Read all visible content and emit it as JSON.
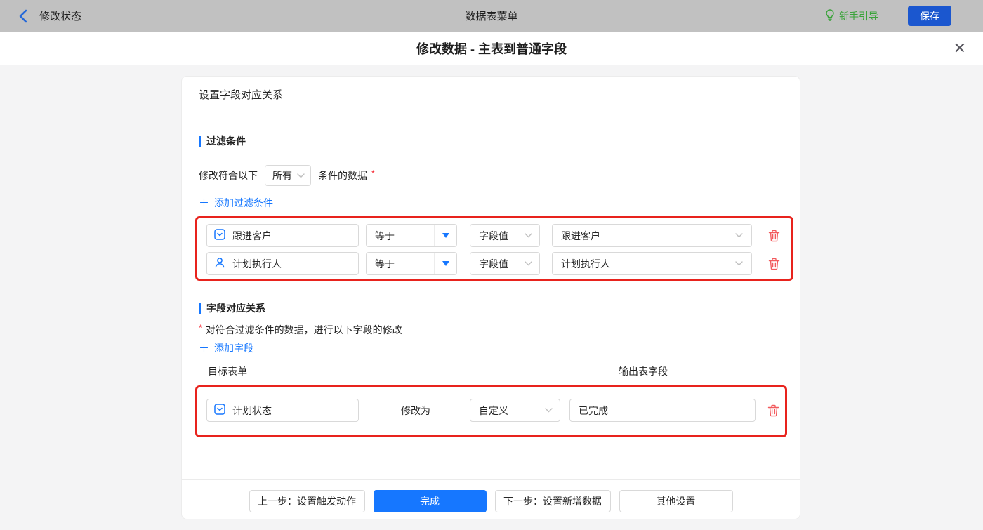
{
  "topbar": {
    "back_label": "修改状态",
    "center_title": "数据表菜单",
    "guide_label": "新手引导",
    "save_label": "保存"
  },
  "modal": {
    "title": "修改数据 - 主表到普通字段"
  },
  "card": {
    "header": "设置字段对应关系",
    "filter_section": {
      "title": "过滤条件",
      "condition_prefix": "修改符合以下",
      "condition_select_value": "所有",
      "condition_suffix": "条件的数据",
      "required_mark": "*",
      "add_label": "添加过滤条件",
      "rows": [
        {
          "field": "跟进客户",
          "field_icon": "select-field-icon",
          "operator": "等于",
          "value_type": "字段值",
          "value": "跟进客户"
        },
        {
          "field": "计划执行人",
          "field_icon": "user-field-icon",
          "operator": "等于",
          "value_type": "字段值",
          "value": "计划执行人"
        }
      ]
    },
    "mapping_section": {
      "title": "字段对应关系",
      "required_mark": "*",
      "description": "对符合过滤条件的数据，进行以下字段的修改",
      "add_label": "添加字段",
      "col_target": "目标表单",
      "col_output": "输出表字段",
      "rows": [
        {
          "field": "计划状态",
          "field_icon": "select-field-icon",
          "action_label": "修改为",
          "mode": "自定义",
          "value": "已完成"
        }
      ]
    },
    "footer": {
      "prev_label": "上一步：设置触发动作",
      "done_label": "完成",
      "next_label": "下一步：设置新增数据",
      "other_label": "其他设置"
    }
  },
  "icons": {
    "plus": "＋",
    "close": "✕",
    "back": "chevron-left",
    "guide": "lightbulb",
    "delete": "trash",
    "dropdown_caret": "filled-triangle-down",
    "select_chevron": "chevron-down"
  },
  "colors": {
    "accent_blue": "#1677ff",
    "save_button_blue": "#1b57cf",
    "annotation_red": "#e8231d",
    "trash_red": "#f25b5e",
    "guide_green": "#3aa33a",
    "topbar_gray": "#c1c1c1",
    "body_gray": "#f4f4f5",
    "border_gray": "#d9d9d9"
  }
}
